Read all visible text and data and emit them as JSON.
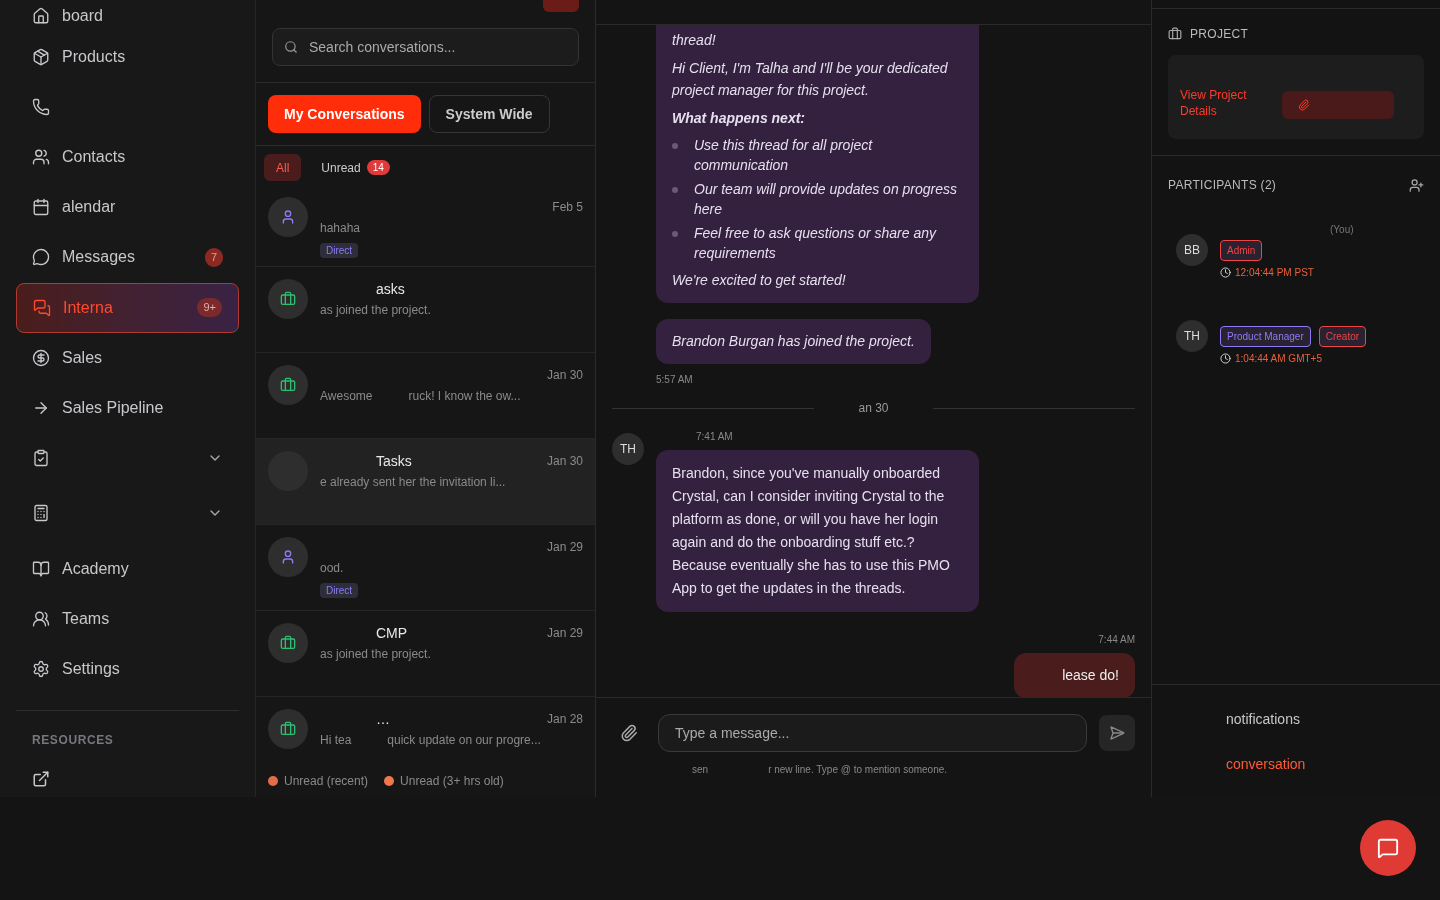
{
  "sidebar": {
    "items": [
      {
        "label": "board",
        "selected": false
      },
      {
        "label": "Products",
        "selected": false
      },
      {
        "selected": false
      },
      {
        "label": "Contacts",
        "selected": false
      },
      {
        "label": "alendar",
        "selected": false
      },
      {
        "label": "Messages",
        "badge": "7",
        "selected": false
      },
      {
        "label": "Interna",
        "badge": "9+",
        "selected": true
      },
      {
        "label": "Sales",
        "selected": false
      },
      {
        "label": "Sales Pipeline",
        "selected": false
      },
      {
        "expandable": true,
        "selected": false
      },
      {
        "expandable": true,
        "selected": false
      },
      {
        "label": "Academy",
        "selected": false
      },
      {
        "label": "Teams",
        "selected": false
      },
      {
        "label": "Settings",
        "selected": false
      }
    ],
    "section_title": "RESOURCES"
  },
  "conversations": {
    "search": {
      "placeholder": "Search conversations..."
    },
    "tabs": [
      {
        "label": "My Conversations",
        "selected": true
      },
      {
        "label": "System Wide",
        "selected": false
      }
    ],
    "filters": [
      {
        "label": "All",
        "selected": true
      },
      {
        "label": "Unread",
        "count": "14",
        "selected": false
      }
    ],
    "rows": [
      {
        "kind": "direct",
        "date": "Feb 5",
        "preview": [
          "hahaha"
        ],
        "tag": "Direct",
        "selected": false
      },
      {
        "kind": "project",
        "title": "asks",
        "preview": [
          "as joined the project."
        ],
        "selected": false
      },
      {
        "kind": "project",
        "date": "Jan 30",
        "preview": [
          "Awesome",
          "ruck! I know the ow..."
        ],
        "selected": false
      },
      {
        "kind": "covered",
        "title": "Tasks",
        "date": "Jan 30",
        "preview": [
          "e already sent her the invitation li..."
        ],
        "selected": true
      },
      {
        "kind": "direct",
        "date": "Jan 29",
        "preview": [
          "ood."
        ],
        "tag": "Direct",
        "selected": false
      },
      {
        "kind": "project",
        "title": "CMP",
        "date": "Jan 29",
        "preview": [
          "as joined the project."
        ],
        "selected": false
      },
      {
        "kind": "project",
        "title": "…",
        "date": "Jan 28",
        "preview": [
          "Hi tea",
          "quick update on our progre..."
        ],
        "selected": false
      }
    ],
    "legend": [
      {
        "label": "Unread (recent)",
        "color": "#e36d48"
      },
      {
        "label": "Unread (3+ hrs old)",
        "color": "#f0784c"
      }
    ]
  },
  "chat": {
    "messages": [
      {
        "kind": "welcome",
        "paragraphs": [
          "thread!",
          "Hi Client, I'm Talha and I'll be your dedicated project manager for this project."
        ],
        "heading": "What happens next:",
        "bullets": [
          "Use this thread for all project communication",
          "Our team will provide updates on progress here",
          "Feel free to ask questions or share any requirements"
        ],
        "closing": "We're excited to get started!"
      },
      {
        "kind": "system",
        "text": "Brandon Burgan has joined the project."
      },
      {
        "kind": "time",
        "text": "5:57 AM"
      },
      {
        "kind": "divider",
        "text": "an 30"
      },
      {
        "kind": "incoming",
        "avatar": "TH",
        "time": "7:41 AM",
        "text": "Brandon, since you've manually onboarded Crystal, can I consider inviting Crystal to the platform as done, or will you have her login again and do the onboarding stuff etc.? Because eventually she has to use this PMO App to get the updates in the threads."
      },
      {
        "kind": "outgoing",
        "time": "7:44 AM",
        "text": "lease do!"
      }
    ],
    "composer": {
      "placeholder": "Type a message...",
      "hint": [
        "sen",
        "r new line. Type @ to mention someone."
      ]
    }
  },
  "details": {
    "project": {
      "title": "PROJECT",
      "link": "View Project Details"
    },
    "participants": {
      "title": "PARTICIPANTS (2)",
      "people": [
        {
          "initials": "BB",
          "you": "(You)",
          "badges": [
            {
              "label": "Admin",
              "color": "#ef4444"
            }
          ],
          "time": "12:04:44 PM PST"
        },
        {
          "initials": "TH",
          "badges": [
            {
              "label": "Product Manager",
              "color": "#8b7cf6"
            },
            {
              "label": "Creator",
              "color": "#ef4444"
            }
          ],
          "time": "1:04:44 AM GMT+5"
        }
      ]
    },
    "actions": [
      {
        "label": "notifications",
        "kind": "plain"
      },
      {
        "label": "conversation",
        "kind": "danger"
      }
    ]
  }
}
